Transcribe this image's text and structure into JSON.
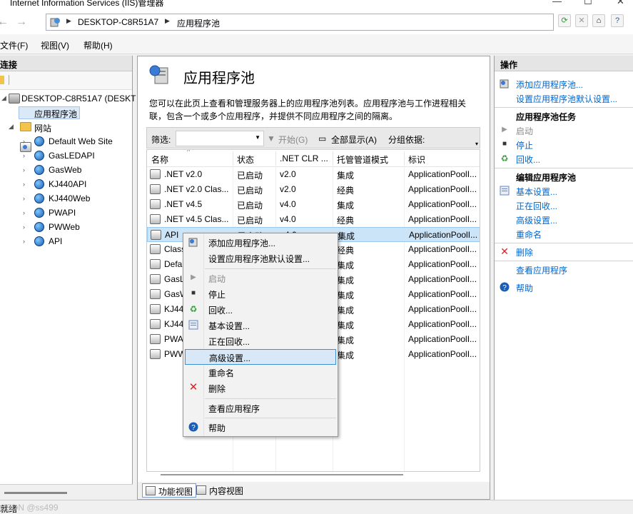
{
  "window": {
    "title": "Internet Information Services (IIS)管理器"
  },
  "address": {
    "crumbs": [
      "DESKTOP-C8R51A7",
      "应用程序池"
    ]
  },
  "menu": {
    "items": [
      "文件(F)",
      "视图(V)",
      "帮助(H)"
    ]
  },
  "connections": {
    "header": "连接",
    "server": "DESKTOP-C8R51A7 (DESKT",
    "app_pools": "应用程序池",
    "sites": "网站",
    "site_list": [
      "Default Web Site",
      "GasLEDAPI",
      "GasWeb",
      "KJ440API",
      "KJ440Web",
      "PWAPI",
      "PWWeb",
      "API"
    ]
  },
  "center": {
    "title": "应用程序池",
    "desc_line1": "您可以在此页上查看和管理服务器上的应用程序池列表。应用程序池与工作进程相关",
    "desc_line2": "联，包含一个或多个应用程序，并提供不同应用程序之间的隔离。",
    "filter": {
      "label": "筛选:",
      "start": "开始(G)",
      "show_all": "全部显示(A)",
      "group_by": "分组依据:"
    },
    "columns": [
      "名称",
      "状态",
      ".NET CLR ...",
      "托管管道模式",
      "标识"
    ],
    "rows": [
      {
        "name": ".NET v2.0",
        "status": "已启动",
        "clr": "v2.0",
        "mode": "集成",
        "identity": "ApplicationPoolI..."
      },
      {
        "name": ".NET v2.0 Clas...",
        "status": "已启动",
        "clr": "v2.0",
        "mode": "经典",
        "identity": "ApplicationPoolI..."
      },
      {
        "name": ".NET v4.5",
        "status": "已启动",
        "clr": "v4.0",
        "mode": "集成",
        "identity": "ApplicationPoolI..."
      },
      {
        "name": ".NET v4.5 Clas...",
        "status": "已启动",
        "clr": "v4.0",
        "mode": "经典",
        "identity": "ApplicationPoolI..."
      },
      {
        "name": "API",
        "status": "已启动",
        "clr": "v4.0",
        "mode": "集成",
        "identity": "ApplicationPoolI..."
      },
      {
        "name": "Class",
        "status": "",
        "clr": "",
        "mode": "经典",
        "identity": "ApplicationPoolI..."
      },
      {
        "name": "Defa",
        "status": "",
        "clr": "",
        "mode": "集成",
        "identity": "ApplicationPoolI..."
      },
      {
        "name": "GasL",
        "status": "",
        "clr": "",
        "mode": "集成",
        "identity": "ApplicationPoolI..."
      },
      {
        "name": "GasW",
        "status": "",
        "clr": "",
        "mode": "集成",
        "identity": "ApplicationPoolI..."
      },
      {
        "name": "KJ44",
        "status": "",
        "clr": "",
        "mode": "集成",
        "identity": "ApplicationPoolI..."
      },
      {
        "name": "KJ44",
        "status": "",
        "clr": "",
        "mode": "集成",
        "identity": "ApplicationPoolI..."
      },
      {
        "name": "PWA",
        "status": "",
        "clr": "",
        "mode": "集成",
        "identity": "ApplicationPoolI..."
      },
      {
        "name": "PWW",
        "status": "",
        "clr": "",
        "mode": "集成",
        "identity": "ApplicationPoolI..."
      }
    ],
    "tabs": {
      "features": "功能视图",
      "content": "内容视图"
    }
  },
  "actions": {
    "header": "操作",
    "add_pool": "添加应用程序池...",
    "set_defaults": "设置应用程序池默认设置...",
    "tasks_header": "应用程序池任务",
    "start": "启动",
    "stop": "停止",
    "recycle": "回收...",
    "edit_header": "编辑应用程序池",
    "basic": "基本设置...",
    "recycling": "正在回收...",
    "advanced": "高级设置...",
    "rename": "重命名",
    "delete": "删除",
    "view_apps": "查看应用程序",
    "help": "帮助"
  },
  "context_menu": {
    "add_pool": "添加应用程序池...",
    "set_defaults": "设置应用程序池默认设置...",
    "start": "启动",
    "stop": "停止",
    "recycle": "回收...",
    "basic": "基本设置...",
    "recycling": "正在回收...",
    "advanced": "高级设置...",
    "rename": "重命名",
    "delete": "删除",
    "view_apps": "查看应用程序",
    "help": "帮助"
  },
  "status": {
    "text": "就绪"
  },
  "watermark": "CSDN @ss499",
  "colors": {
    "link": "#0066cc",
    "selection": "#cce4f7",
    "delete_red": "#d9232d",
    "recycle_green": "#2e9a35"
  }
}
